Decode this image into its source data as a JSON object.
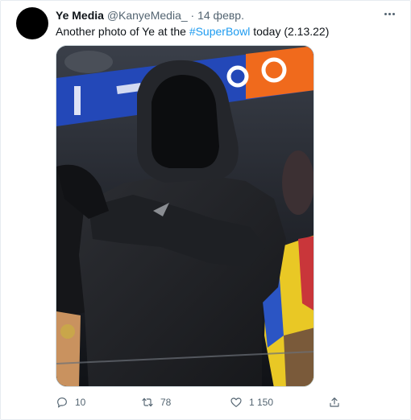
{
  "tweet": {
    "display_name": "Ye Media",
    "handle": "@KanyeMedia_",
    "separator": "·",
    "date": "14 февр.",
    "text_before": "Another photo of Ye at the ",
    "hashtag": "#SuperBowl",
    "text_after": " today (2.13.22)"
  },
  "actions": {
    "replies": "10",
    "retweets": "78",
    "likes": "1 150"
  },
  "icons": {
    "more": "more-horizontal-icon",
    "reply": "reply-icon",
    "retweet": "retweet-icon",
    "like": "heart-icon",
    "share": "share-icon"
  },
  "colors": {
    "link": "#1d9bf0",
    "secondary_text": "#536471"
  }
}
